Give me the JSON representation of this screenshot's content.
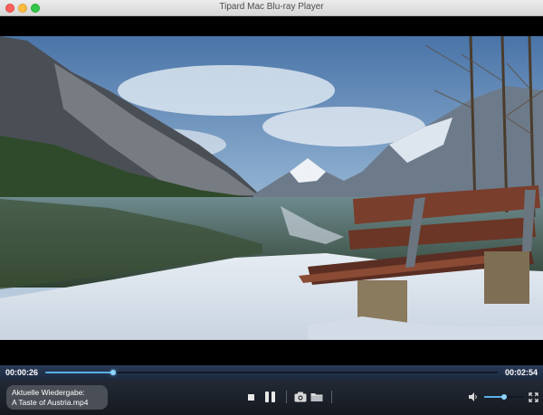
{
  "window": {
    "title": "Tipard Mac Blu-ray Player"
  },
  "player": {
    "current_time": "00:00:26",
    "total_time": "00:02:54",
    "progress": 0.15,
    "volume": 0.5
  },
  "now_playing": {
    "label": "Aktuelle Wiedergabe:",
    "file": "A Taste of Austria.mp4"
  },
  "icons": [
    "stop-icon",
    "pause-icon",
    "camera-icon",
    "folder-icon",
    "speaker-icon",
    "fullscreen-icon"
  ],
  "colors": {
    "accent": "#5ab0e8",
    "bar_bg": "#1c2940",
    "controls_bg": "#1a1f27"
  }
}
